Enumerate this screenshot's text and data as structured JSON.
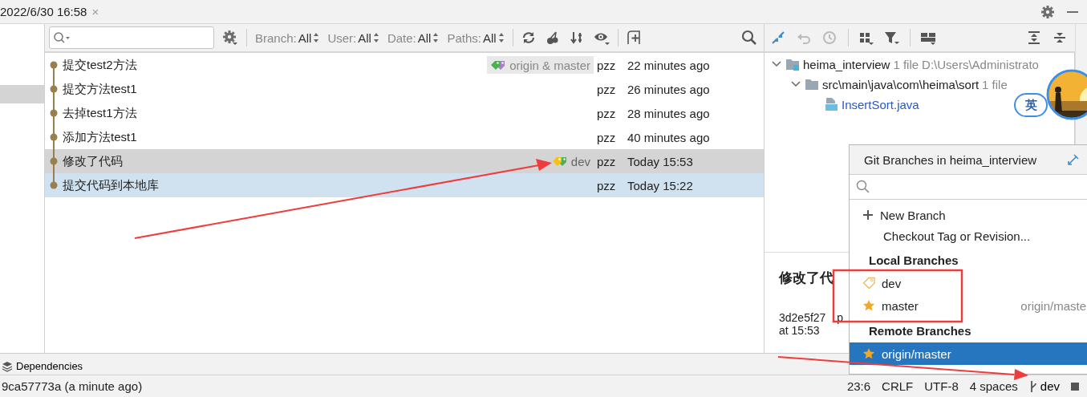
{
  "tab": {
    "title": "2022/6/30 16:58",
    "close": "×"
  },
  "log_toolbar": {
    "filters": [
      {
        "label": "Branch:",
        "value": "All"
      },
      {
        "label": "User:",
        "value": "All"
      },
      {
        "label": "Date:",
        "value": "All"
      },
      {
        "label": "Paths:",
        "value": "All"
      }
    ]
  },
  "commits": [
    {
      "message": "提交test2方法",
      "refs": [
        {
          "label": "origin & master",
          "kind": "remote"
        }
      ],
      "author": "pzz",
      "date": "22 minutes ago",
      "selected": false,
      "highlighted": false
    },
    {
      "message": "提交方法test1",
      "author": "pzz",
      "date": "26 minutes ago",
      "selected": false,
      "highlighted": false
    },
    {
      "message": "去掉test1方法",
      "author": "pzz",
      "date": "28 minutes ago",
      "selected": false,
      "highlighted": false
    },
    {
      "message": "添加方法test1",
      "author": "pzz",
      "date": "40 minutes ago",
      "selected": false,
      "highlighted": false
    },
    {
      "message": "修改了代码",
      "refs": [
        {
          "label": "dev",
          "kind": "local"
        }
      ],
      "author": "pzz",
      "date": "Today 15:53",
      "selected": false,
      "highlighted": true
    },
    {
      "message": "提交代码到本地库",
      "author": "pzz",
      "date": "Today 15:22",
      "selected": true,
      "highlighted": false
    }
  ],
  "changes": {
    "tree": [
      {
        "name": "heima_interview",
        "count": "1 file",
        "path": "D:\\Users\\Administrato",
        "kind": "module",
        "expanded": true,
        "children": [
          {
            "name": "src\\main\\java\\com\\heima\\sort",
            "count": "1 file",
            "kind": "folder",
            "expanded": true,
            "children": [
              {
                "name": "InsertSort.java",
                "kind": "file"
              }
            ]
          }
        ]
      }
    ]
  },
  "details": {
    "title": "修改了代",
    "hash": "3d2e5f27 p",
    "time": "at 15:53"
  },
  "ime": {
    "label": "英"
  },
  "branches_popup": {
    "title": "Git Branches in heima_interview",
    "actions": [
      {
        "label": "New Branch",
        "kind": "new"
      },
      {
        "label": "Checkout Tag or Revision...",
        "kind": "plain"
      }
    ],
    "sections": [
      {
        "title": "Local Branches",
        "items": [
          {
            "name": "dev",
            "kind": "current",
            "selected": false
          },
          {
            "name": "master",
            "kind": "favorite",
            "tracking": "origin/maste",
            "selected": false
          }
        ]
      },
      {
        "title": "Remote Branches",
        "items": [
          {
            "name": "origin/master",
            "kind": "favorite",
            "selected": true
          }
        ]
      }
    ]
  },
  "bottom_tabs": [
    "Dependencies"
  ],
  "status_bar": {
    "commit": "9ca57773a (a minute ago)",
    "items": [
      "23:6",
      "CRLF",
      "UTF-8",
      "4 spaces"
    ],
    "branch": "dev"
  }
}
